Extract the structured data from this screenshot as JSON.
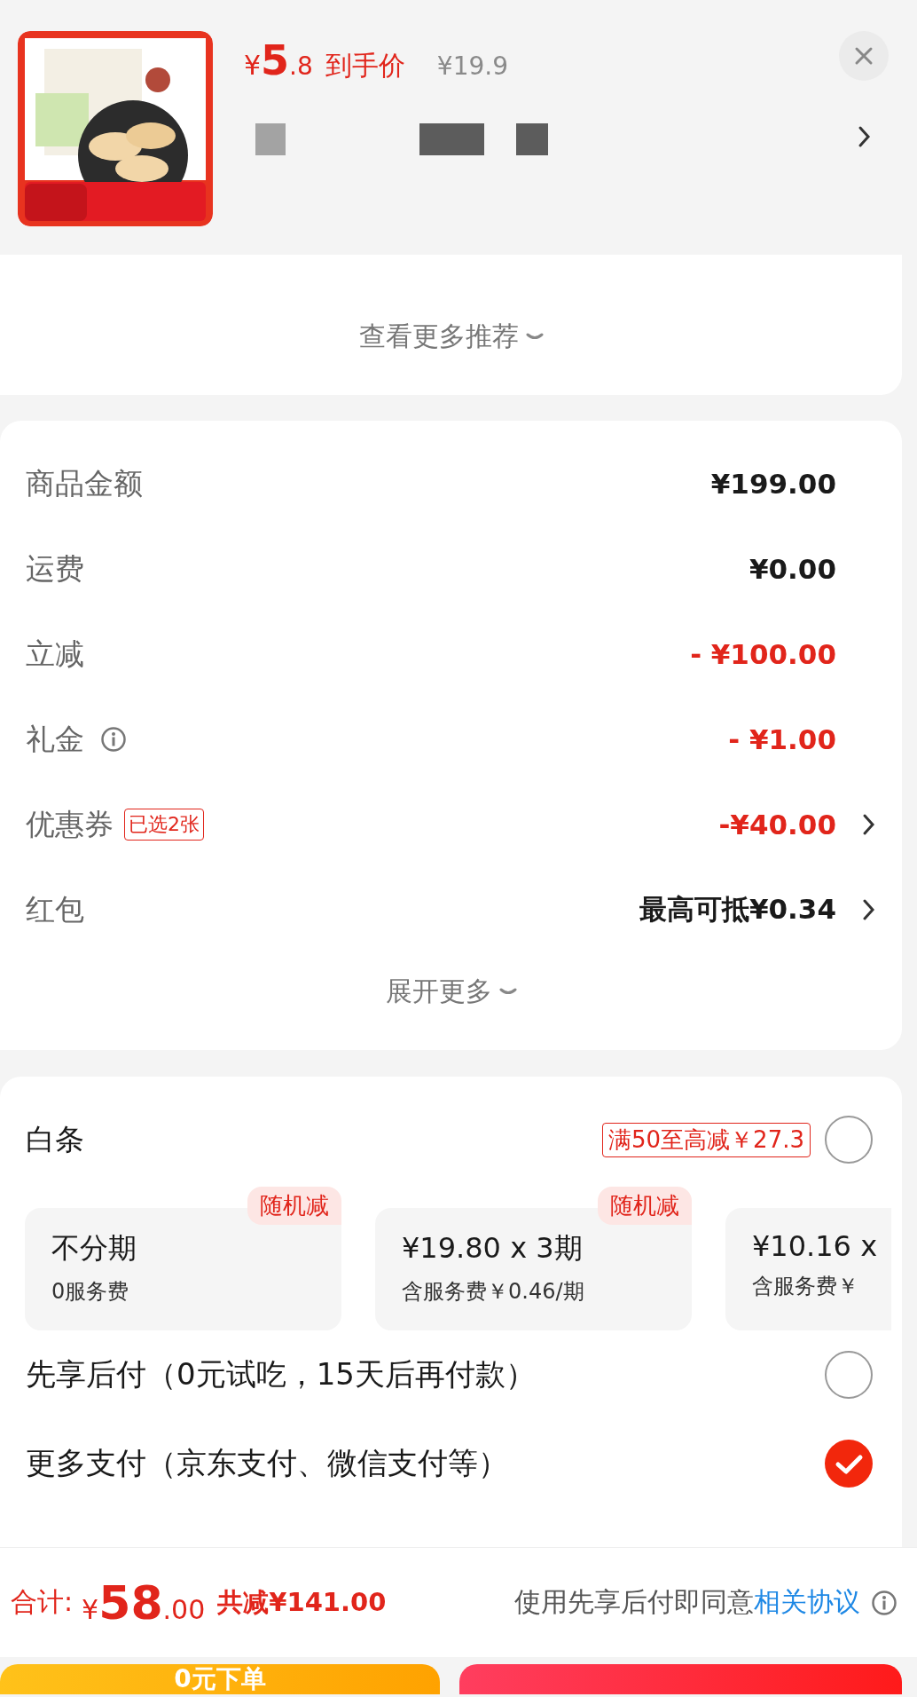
{
  "floating_product": {
    "price": {
      "symbol": "¥",
      "integer": "5",
      "decimal": ".8"
    },
    "price_label": "到手价",
    "original_price": "¥19.9",
    "redactions": [
      {
        "color": "#a3a3a3"
      },
      {
        "color": "#5c5c5c"
      },
      {
        "color": "#5c5c5c"
      }
    ]
  },
  "recommendations_link": "查看更多推荐",
  "summary": {
    "rows": [
      {
        "label": "商品金额",
        "value": "¥199.00",
        "kind": "plain",
        "info": false,
        "arrow": false
      },
      {
        "label": "运费",
        "value": "¥0.00",
        "kind": "plain",
        "info": false,
        "arrow": false
      },
      {
        "label": "立减",
        "value": "- ¥100.00",
        "kind": "discount",
        "info": false,
        "arrow": false
      },
      {
        "label": "礼金",
        "value": "- ¥1.00",
        "kind": "discount",
        "info": true,
        "arrow": false
      },
      {
        "label": "优惠券",
        "tag": "已选2张",
        "value": "-¥40.00",
        "kind": "discount",
        "info": false,
        "arrow": true
      },
      {
        "label": "红包",
        "value": "最高可抵¥0.34",
        "kind": "plain",
        "info": false,
        "arrow": true
      }
    ],
    "expand_link": "展开更多"
  },
  "payment": {
    "baitiao": {
      "label": "白条",
      "promo": "满50至高减￥27.3",
      "selected": false
    },
    "plans": [
      {
        "title": "不分期",
        "subtitle": "0服务费",
        "badge": "随机减"
      },
      {
        "title": "¥19.80 x 3期",
        "subtitle": "含服务费￥0.46/期",
        "badge": "随机减"
      },
      {
        "title": "¥10.16 x",
        "subtitle": "含服务费￥"
      }
    ],
    "options": [
      {
        "label": "先享后付（0元试吃，15天后再付款）",
        "selected": false
      },
      {
        "label": "更多支付（京东支付、微信支付等）",
        "selected": true
      }
    ]
  },
  "footer": {
    "total_label": "合计:",
    "total": {
      "symbol": "¥",
      "integer": "58",
      "decimal": ".00"
    },
    "saved": "共减¥141.00",
    "agreement_text": "使用先享后付即同意",
    "agreement_link": "相关协议",
    "buttons": [
      {
        "label": "0元下单",
        "kind": "secondary"
      },
      {
        "kind": "primary"
      }
    ]
  }
}
